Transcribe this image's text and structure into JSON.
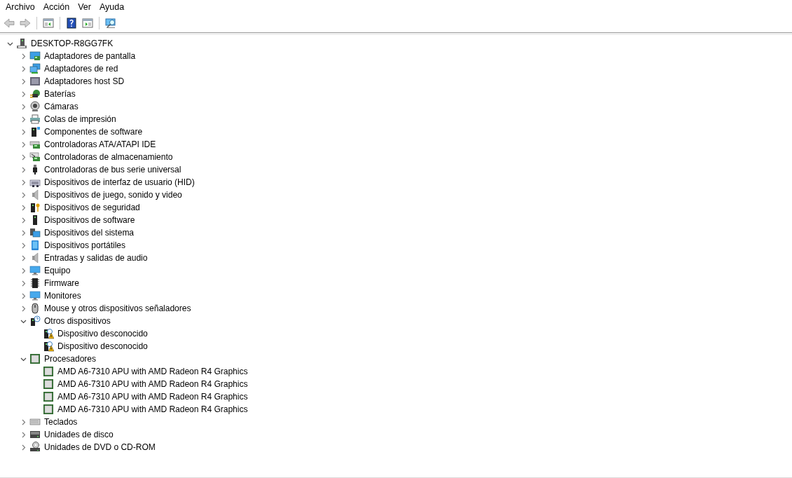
{
  "menu": [
    "Archivo",
    "Acción",
    "Ver",
    "Ayuda"
  ],
  "toolbar": [
    {
      "kind": "back",
      "disabled": true
    },
    {
      "kind": "forward",
      "disabled": true
    },
    {
      "kind": "separator"
    },
    {
      "kind": "console-tree"
    },
    {
      "kind": "separator"
    },
    {
      "kind": "help"
    },
    {
      "kind": "action-pane"
    },
    {
      "kind": "separator"
    },
    {
      "kind": "scan"
    }
  ],
  "tree": [
    {
      "label": "DESKTOP-R8GG7FK",
      "kind": "computer",
      "expanded": true,
      "children": [
        {
          "label": "Adaptadores de pantalla",
          "kind": "display",
          "expanded": false
        },
        {
          "label": "Adaptadores de red",
          "kind": "network",
          "expanded": false
        },
        {
          "label": "Adaptadores host SD",
          "kind": "sd",
          "expanded": false
        },
        {
          "label": "Baterías",
          "kind": "battery",
          "expanded": false
        },
        {
          "label": "Cámaras",
          "kind": "camera",
          "expanded": false
        },
        {
          "label": "Colas de impresión",
          "kind": "printer",
          "expanded": false
        },
        {
          "label": "Componentes de software",
          "kind": "software",
          "expanded": false
        },
        {
          "label": "Controladoras ATA/ATAPI IDE",
          "kind": "ide",
          "expanded": false
        },
        {
          "label": "Controladoras de almacenamiento",
          "kind": "storage",
          "expanded": false
        },
        {
          "label": "Controladoras de bus serie universal",
          "kind": "usb",
          "expanded": false
        },
        {
          "label": "Dispositivos de interfaz de usuario (HID)",
          "kind": "hid",
          "expanded": false
        },
        {
          "label": "Dispositivos de juego, sonido y video",
          "kind": "speaker",
          "expanded": false
        },
        {
          "label": "Dispositivos de seguridad",
          "kind": "security",
          "expanded": false
        },
        {
          "label": "Dispositivos de software",
          "kind": "tower",
          "expanded": false
        },
        {
          "label": "Dispositivos del sistema",
          "kind": "system",
          "expanded": false
        },
        {
          "label": "Dispositivos portátiles",
          "kind": "portable",
          "expanded": false
        },
        {
          "label": "Entradas y salidas de audio",
          "kind": "speaker",
          "expanded": false
        },
        {
          "label": "Equipo",
          "kind": "monitor",
          "expanded": false
        },
        {
          "label": "Firmware",
          "kind": "firmware",
          "expanded": false
        },
        {
          "label": "Monitores",
          "kind": "monitor",
          "expanded": false
        },
        {
          "label": "Mouse y otros dispositivos señaladores",
          "kind": "mouse",
          "expanded": false
        },
        {
          "label": "Otros dispositivos",
          "kind": "other",
          "expanded": true,
          "children": [
            {
              "label": "Dispositivo desconocido",
              "kind": "unknown"
            },
            {
              "label": "Dispositivo desconocido",
              "kind": "unknown"
            }
          ]
        },
        {
          "label": "Procesadores",
          "kind": "cpu",
          "expanded": true,
          "children": [
            {
              "label": "AMD A6-7310 APU with AMD Radeon R4 Graphics",
              "kind": "cpu"
            },
            {
              "label": "AMD A6-7310 APU with AMD Radeon R4 Graphics",
              "kind": "cpu"
            },
            {
              "label": "AMD A6-7310 APU with AMD Radeon R4 Graphics",
              "kind": "cpu"
            },
            {
              "label": "AMD A6-7310 APU with AMD Radeon R4 Graphics",
              "kind": "cpu"
            }
          ]
        },
        {
          "label": "Teclados",
          "kind": "keyboard",
          "expanded": false
        },
        {
          "label": "Unidades de disco",
          "kind": "disk",
          "expanded": false
        },
        {
          "label": "Unidades de DVD o CD-ROM",
          "kind": "dvd",
          "expanded": false
        }
      ]
    }
  ]
}
